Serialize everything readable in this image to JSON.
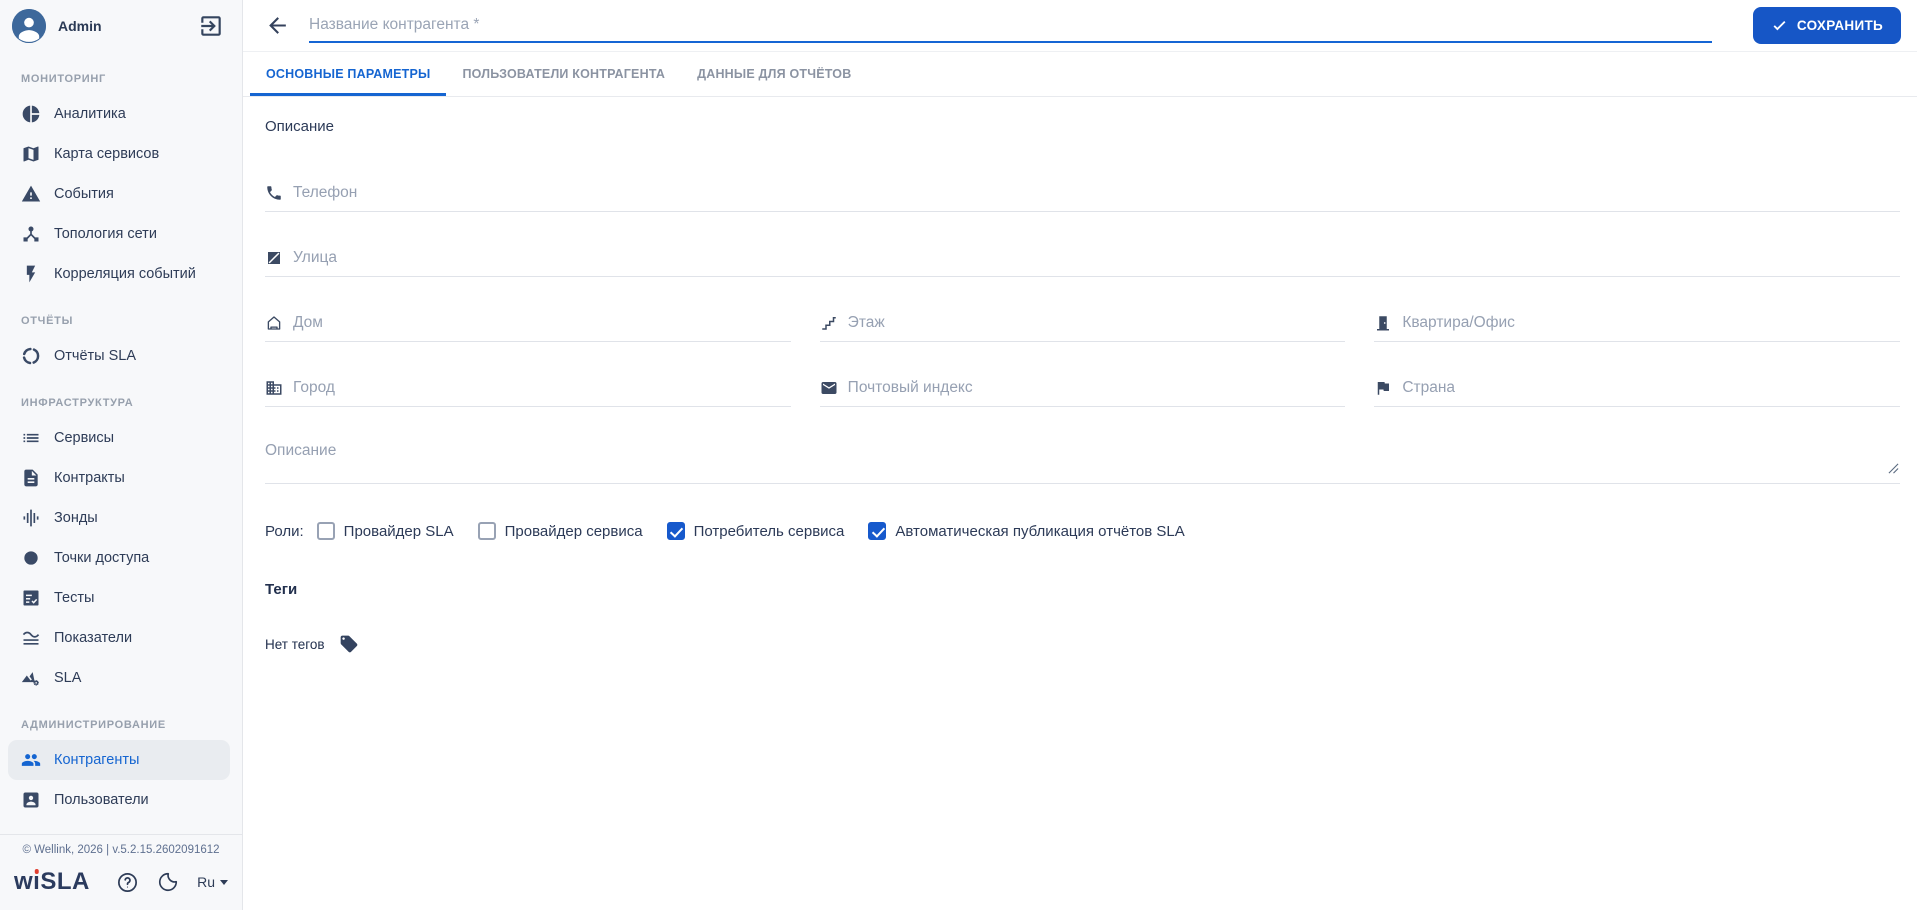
{
  "colors": {
    "accent": "#1565d1",
    "button_bg": "#1656c6",
    "sidebar_bg": "#f7f8fa"
  },
  "user": {
    "name": "Admin"
  },
  "sidebar": {
    "sections": [
      {
        "label": "МОНИТОРИНГ",
        "items": [
          {
            "icon": "analytics-icon",
            "label": "Аналитика"
          },
          {
            "icon": "service-map-icon",
            "label": "Карта сервисов"
          },
          {
            "icon": "events-icon",
            "label": "События"
          },
          {
            "icon": "topology-icon",
            "label": "Топология сети"
          },
          {
            "icon": "correlation-icon",
            "label": "Корреляция событий"
          }
        ]
      },
      {
        "label": "ОТЧЁТЫ",
        "items": [
          {
            "icon": "sla-reports-icon",
            "label": "Отчёты SLA"
          }
        ]
      },
      {
        "label": "ИНФРАСТРУКТУРА",
        "items": [
          {
            "icon": "services-icon",
            "label": "Сервисы"
          },
          {
            "icon": "contracts-icon",
            "label": "Контракты"
          },
          {
            "icon": "probes-icon",
            "label": "Зонды"
          },
          {
            "icon": "access-points-icon",
            "label": "Точки доступа"
          },
          {
            "icon": "tests-icon",
            "label": "Тесты"
          },
          {
            "icon": "metrics-icon",
            "label": "Показатели"
          },
          {
            "icon": "sla-icon",
            "label": "SLA"
          }
        ]
      },
      {
        "label": "АДМИНИСТРИРОВАНИЕ",
        "items": [
          {
            "icon": "counterparties-icon",
            "label": "Контрагенты",
            "active": true
          },
          {
            "icon": "users-icon",
            "label": "Пользователи"
          }
        ]
      }
    ],
    "footer": {
      "version": "© Wellink, 2026 | v.5.2.15.2602091612",
      "logo": {
        "pre": "w",
        "i": "ı",
        "post": "SLA"
      },
      "lang": "Ru"
    }
  },
  "header": {
    "title_placeholder": "Название контрагента *",
    "save_label": "СОХРАНИТЬ"
  },
  "tabs": [
    {
      "label": "ОСНОВНЫЕ ПАРАМЕТРЫ",
      "active": true
    },
    {
      "label": "ПОЛЬЗОВАТЕЛИ КОНТРАГЕНТА",
      "active": false
    },
    {
      "label": "ДАННЫЕ ДЛЯ ОТЧЁТОВ",
      "active": false
    }
  ],
  "form": {
    "section_title": "Описание",
    "phone_placeholder": "Телефон",
    "street_placeholder": "Улица",
    "house_placeholder": "Дом",
    "floor_placeholder": "Этаж",
    "apartment_placeholder": "Квартира/Офис",
    "city_placeholder": "Город",
    "postal_placeholder": "Почтовый индекс",
    "country_placeholder": "Страна",
    "description_placeholder": "Описание",
    "roles": {
      "label": "Роли:",
      "options": [
        {
          "label": "Провайдер SLA",
          "checked": false
        },
        {
          "label": "Провайдер сервиса",
          "checked": false
        },
        {
          "label": "Потребитель сервиса",
          "checked": true
        },
        {
          "label": "Автоматическая публикация отчётов SLA",
          "checked": true
        }
      ]
    },
    "tags": {
      "title": "Теги",
      "empty_text": "Нет тегов"
    }
  }
}
